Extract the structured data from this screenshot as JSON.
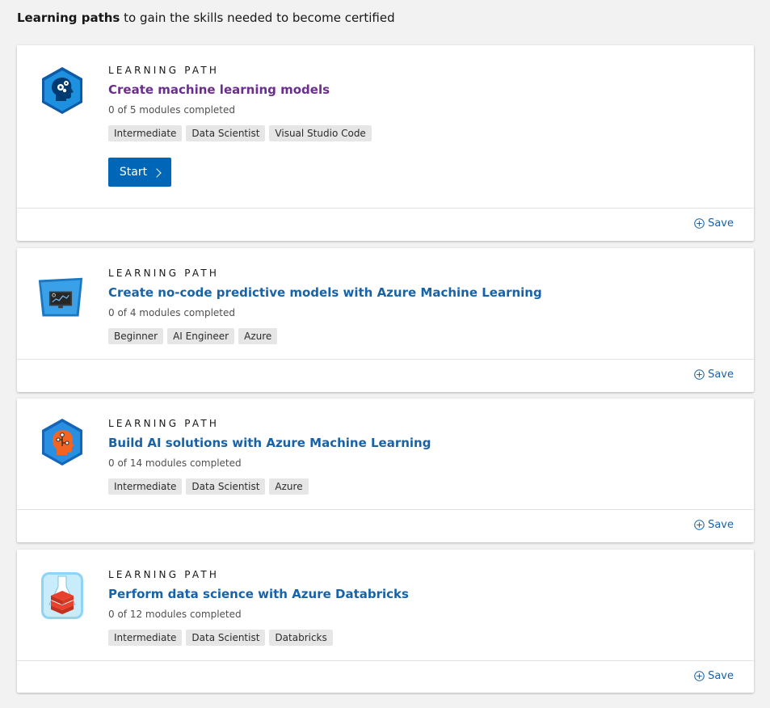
{
  "header": {
    "bold_text": "Learning paths",
    "rest_text": " to gain the skills needed to become certified"
  },
  "paths": [
    {
      "eyebrow": "LEARNING PATH",
      "title": "Create machine learning models",
      "progress": "0 of 5 modules completed",
      "tags": [
        "Intermediate",
        "Data Scientist",
        "Visual Studio Code"
      ],
      "start_label": "Start",
      "save_label": "Save",
      "icon": "ml-models-badge-icon"
    },
    {
      "eyebrow": "LEARNING PATH",
      "title": "Create no-code predictive models with Azure Machine Learning",
      "progress": "0 of 4 modules completed",
      "tags": [
        "Beginner",
        "AI Engineer",
        "Azure"
      ],
      "save_label": "Save",
      "icon": "monitor-chart-badge-icon"
    },
    {
      "eyebrow": "LEARNING PATH",
      "title": "Build AI solutions with Azure Machine Learning",
      "progress": "0 of 14 modules completed",
      "tags": [
        "Intermediate",
        "Data Scientist",
        "Azure"
      ],
      "save_label": "Save",
      "icon": "ai-head-badge-icon"
    },
    {
      "eyebrow": "LEARNING PATH",
      "title": "Perform data science with Azure Databricks",
      "progress": "0 of 12 modules completed",
      "tags": [
        "Intermediate",
        "Data Scientist",
        "Databricks"
      ],
      "save_label": "Save",
      "icon": "databricks-flask-badge-icon"
    }
  ],
  "colors": {
    "link": "#1862a8",
    "visited_link": "#6b2d8e",
    "button": "#0067b8",
    "background": "#f2f2f2"
  }
}
